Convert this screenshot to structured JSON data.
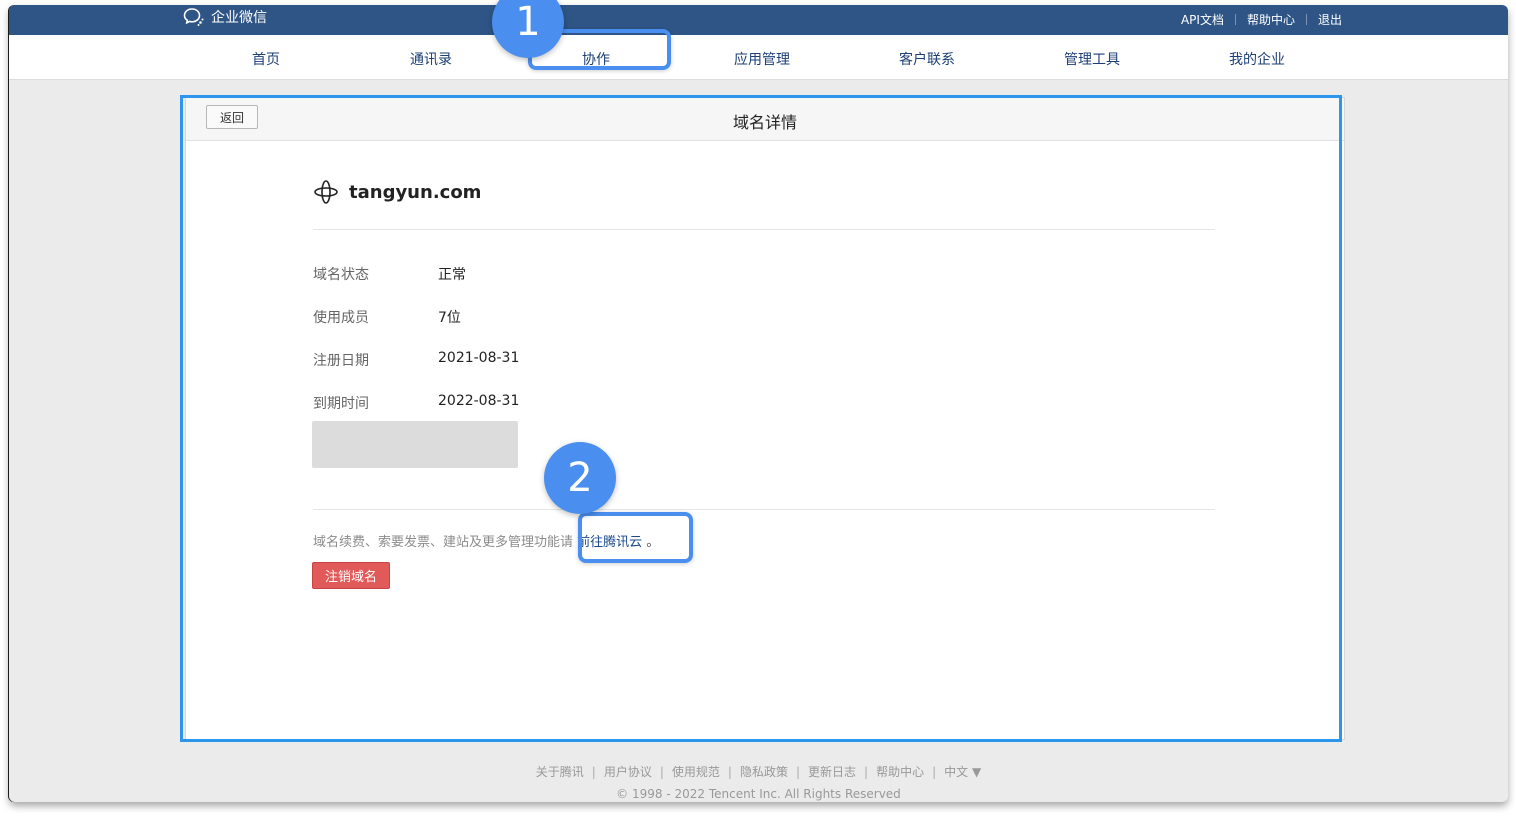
{
  "topbar": {
    "logo_text": "企业微信",
    "links": [
      "API文档",
      "帮助中心",
      "退出"
    ]
  },
  "nav": {
    "items": [
      "首页",
      "通讯录",
      "协作",
      "应用管理",
      "客户联系",
      "管理工具",
      "我的企业"
    ],
    "active": "协作"
  },
  "detail": {
    "back_label": "返回",
    "title": "域名详情",
    "domain": "tangyun.com",
    "fields": [
      {
        "label": "域名状态",
        "value": "正常"
      },
      {
        "label": "使用成员",
        "value": "7位"
      },
      {
        "label": "注册日期",
        "value": "2021-08-31"
      },
      {
        "label": "到期时间",
        "value": "2022-08-31"
      }
    ],
    "hint_text": "域名续费、索要发票、建站及更多管理功能请",
    "hint_link": "前往腾讯云",
    "hint_period": "。",
    "cancel_label": "注销域名"
  },
  "footer": {
    "links": [
      "关于腾讯",
      "用户协议",
      "使用规范",
      "隐私政策",
      "更新日志",
      "帮助中心",
      "中文 ▼"
    ],
    "copyright": "© 1998 - 2022 Tencent Inc. All Rights Reserved"
  },
  "annotations": {
    "step1": "1",
    "step2": "2",
    "color": "#4a8ff0"
  }
}
